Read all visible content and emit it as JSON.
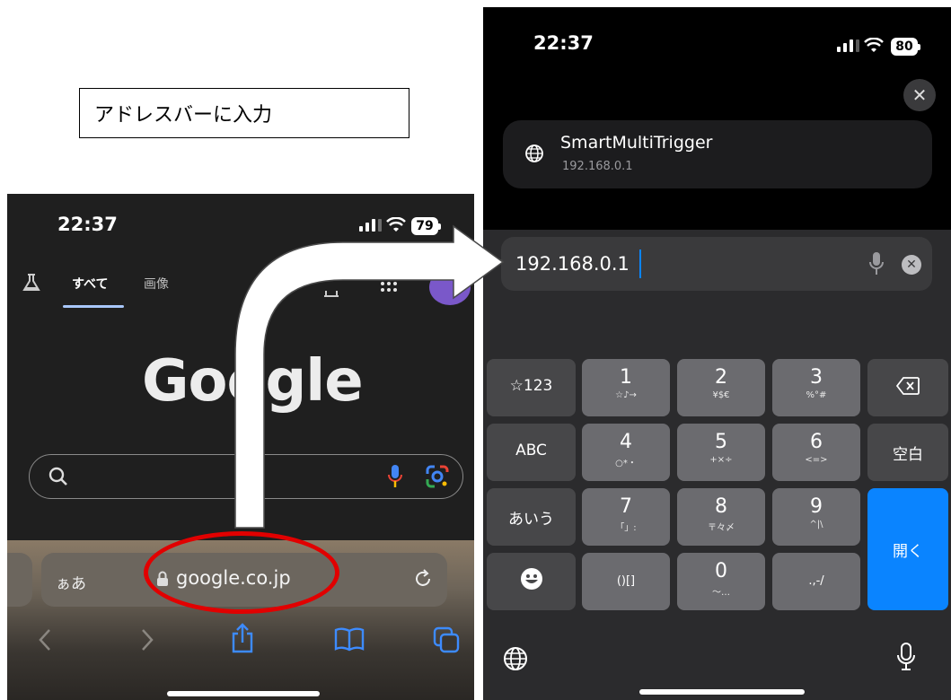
{
  "annotation": {
    "label": "アドレスバーに入力"
  },
  "left_phone": {
    "status": {
      "time": "22:37",
      "battery": "79"
    },
    "tabs": {
      "all": "すべて",
      "images": "画像"
    },
    "logo": "Google",
    "address_bar": {
      "aa": "ぁあ",
      "url": "google.co.jp"
    }
  },
  "right_phone": {
    "status": {
      "time": "22:37",
      "battery": "80"
    },
    "suggestion": {
      "title": "SmartMultiTrigger",
      "subtitle": "192.168.0.1"
    },
    "url_field": {
      "value": "192.168.0.1"
    },
    "keyboard": {
      "sym_key": "☆123",
      "abc_key": "ABC",
      "kana_key": "あいう",
      "space_key": "空白",
      "open_key": "開く",
      "keys": [
        {
          "main": "1",
          "sub": "☆♪→"
        },
        {
          "main": "2",
          "sub": "¥$€"
        },
        {
          "main": "3",
          "sub": "%°#"
        },
        {
          "main": "4",
          "sub": "○*・"
        },
        {
          "main": "5",
          "sub": "+×÷"
        },
        {
          "main": "6",
          "sub": "<=>"
        },
        {
          "main": "7",
          "sub": "「」:"
        },
        {
          "main": "8",
          "sub": "〒々〆"
        },
        {
          "main": "9",
          "sub": "^|\\"
        },
        {
          "main": "0",
          "sub": "〜…"
        }
      ],
      "brackets_key": "()[]",
      "punct_key": ".,-/"
    }
  }
}
